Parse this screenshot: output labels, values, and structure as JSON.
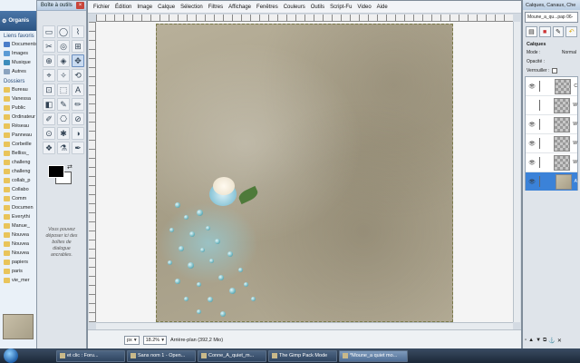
{
  "explorer": {
    "organize_label": "Organis",
    "favorites_header": "Liens favoris",
    "favorites": [
      "Documents",
      "Images",
      "Musique",
      "Autres"
    ],
    "folders_header": "Dossiers",
    "folders": [
      "Bureau",
      "Vanessa",
      "Public",
      "Ordinateur",
      "Réseau",
      "Panneau",
      "Corbeille",
      "Belliss_",
      "challeng",
      "challeng",
      "collab_p",
      "Collabo",
      "Comm",
      "Documen",
      "Everythi",
      "Manue_",
      "Nouvea",
      "Nouvea",
      "Nouvea",
      "papiers",
      "paris",
      "vie_mer"
    ]
  },
  "toolbox": {
    "title": "Boîte à outils",
    "tools": [
      "▭",
      "◯",
      "⌇",
      "✂",
      "◎",
      "⊞",
      "⊕",
      "◈",
      "✥",
      "⌖",
      "✧",
      "⟲",
      "⊡",
      "⬚",
      "A",
      "◧",
      "✎",
      "✏",
      "✐",
      "⎔",
      "⊘",
      "⊙",
      "✱",
      "◑",
      "❖",
      "⚗",
      "✒"
    ],
    "dock_hint": "Vous pouvez déposer ici des boîtes de dialogue ancrables."
  },
  "image_window": {
    "menu": [
      "Fichier",
      "Édition",
      "Image",
      "Calque",
      "Sélection",
      "Filtres",
      "Affichage",
      "Fenêtres",
      "Couleurs",
      "Outils",
      "Script-Fu",
      "Video",
      "Aide"
    ],
    "status": {
      "unit": "px",
      "zoom": "18.2%",
      "layer_info": "Arrière-plan (392,2 Mio)"
    }
  },
  "layers_dock": {
    "title": "Calques, Canaux, Che",
    "image_name": "Moune_a_qu...pap 06-",
    "tabs": [
      "layers",
      "channels",
      "paths",
      "undo"
    ],
    "header": "Calques",
    "mode_label": "Mode :",
    "mode_value": "Normal",
    "opacity_label": "Opacité :",
    "lock_label": "Verrouiller :",
    "layers": [
      {
        "name": "C",
        "visible": true,
        "active": false
      },
      {
        "name": "W",
        "visible": false,
        "active": false
      },
      {
        "name": "W",
        "visible": true,
        "active": false
      },
      {
        "name": "W",
        "visible": true,
        "active": false
      },
      {
        "name": "W",
        "visible": true,
        "active": false
      },
      {
        "name": "A",
        "visible": true,
        "active": true
      }
    ]
  },
  "taskbar": {
    "tasks": [
      {
        "label": "et clic : Foru...",
        "active": false
      },
      {
        "label": "Sans nom 1 - Open...",
        "active": false
      },
      {
        "label": "Conne_A_quiet_m...",
        "active": false
      },
      {
        "label": "The Gimp Pack Mode",
        "active": false
      },
      {
        "label": "*Moune_a quiet mo...",
        "active": true
      }
    ]
  },
  "colors": {
    "active_layer": "#3b82d8",
    "foreground": "#000000",
    "background": "#ffffff"
  }
}
